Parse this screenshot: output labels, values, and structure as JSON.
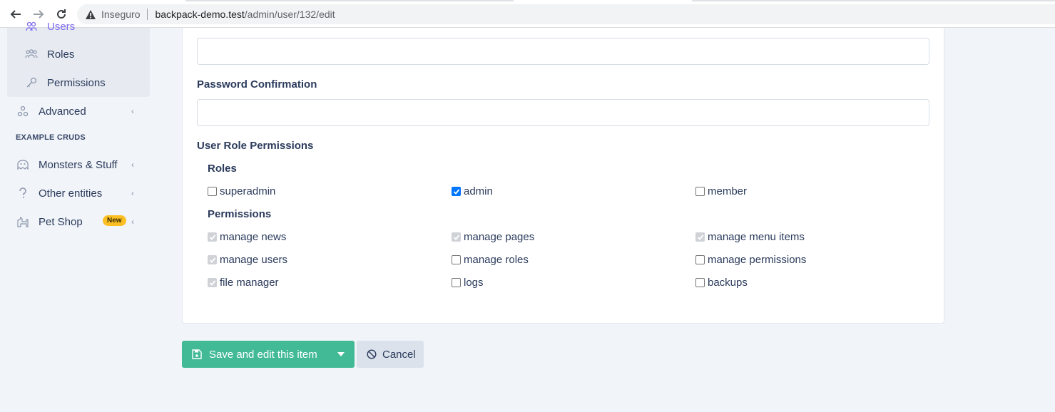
{
  "browser": {
    "security_label": "Inseguro",
    "url_host": "backpack-demo.test",
    "url_path": "/admin/user/132/edit"
  },
  "sidebar": {
    "items": [
      {
        "label": "Users",
        "icon": "users-icon"
      },
      {
        "label": "Roles",
        "icon": "user-group-icon"
      },
      {
        "label": "Permissions",
        "icon": "key-icon"
      },
      {
        "label": "Advanced",
        "icon": "cogs-icon"
      }
    ],
    "section_title": "EXAMPLE CRUDS",
    "section_items": [
      {
        "label": "Monsters & Stuff",
        "icon": "monster-icon"
      },
      {
        "label": "Other entities",
        "icon": "question-icon"
      },
      {
        "label": "Pet Shop",
        "icon": "dog-icon",
        "badge": "New"
      }
    ]
  },
  "form": {
    "password_confirmation_label": "Password Confirmation",
    "permissions_section_label": "User Role Permissions",
    "roles_label": "Roles",
    "roles": [
      {
        "label": "superadmin",
        "checked": false
      },
      {
        "label": "admin",
        "checked": true
      },
      {
        "label": "member",
        "checked": false
      }
    ],
    "permissions_label": "Permissions",
    "permissions": [
      {
        "label": "manage news",
        "checked": true,
        "disabled": true
      },
      {
        "label": "manage pages",
        "checked": true,
        "disabled": true
      },
      {
        "label": "manage menu items",
        "checked": true,
        "disabled": true
      },
      {
        "label": "manage users",
        "checked": true,
        "disabled": true
      },
      {
        "label": "manage roles",
        "checked": false,
        "disabled": false
      },
      {
        "label": "manage permissions",
        "checked": false,
        "disabled": false
      },
      {
        "label": "file manager",
        "checked": true,
        "disabled": true
      },
      {
        "label": "logs",
        "checked": false,
        "disabled": false
      },
      {
        "label": "backups",
        "checked": false,
        "disabled": false
      }
    ]
  },
  "actions": {
    "save_label": "Save and edit this item",
    "cancel_label": "Cancel"
  },
  "colors": {
    "primary_success": "#42ba96",
    "badge": "#fbbf24",
    "checkbox_checked": "#0075ff"
  }
}
